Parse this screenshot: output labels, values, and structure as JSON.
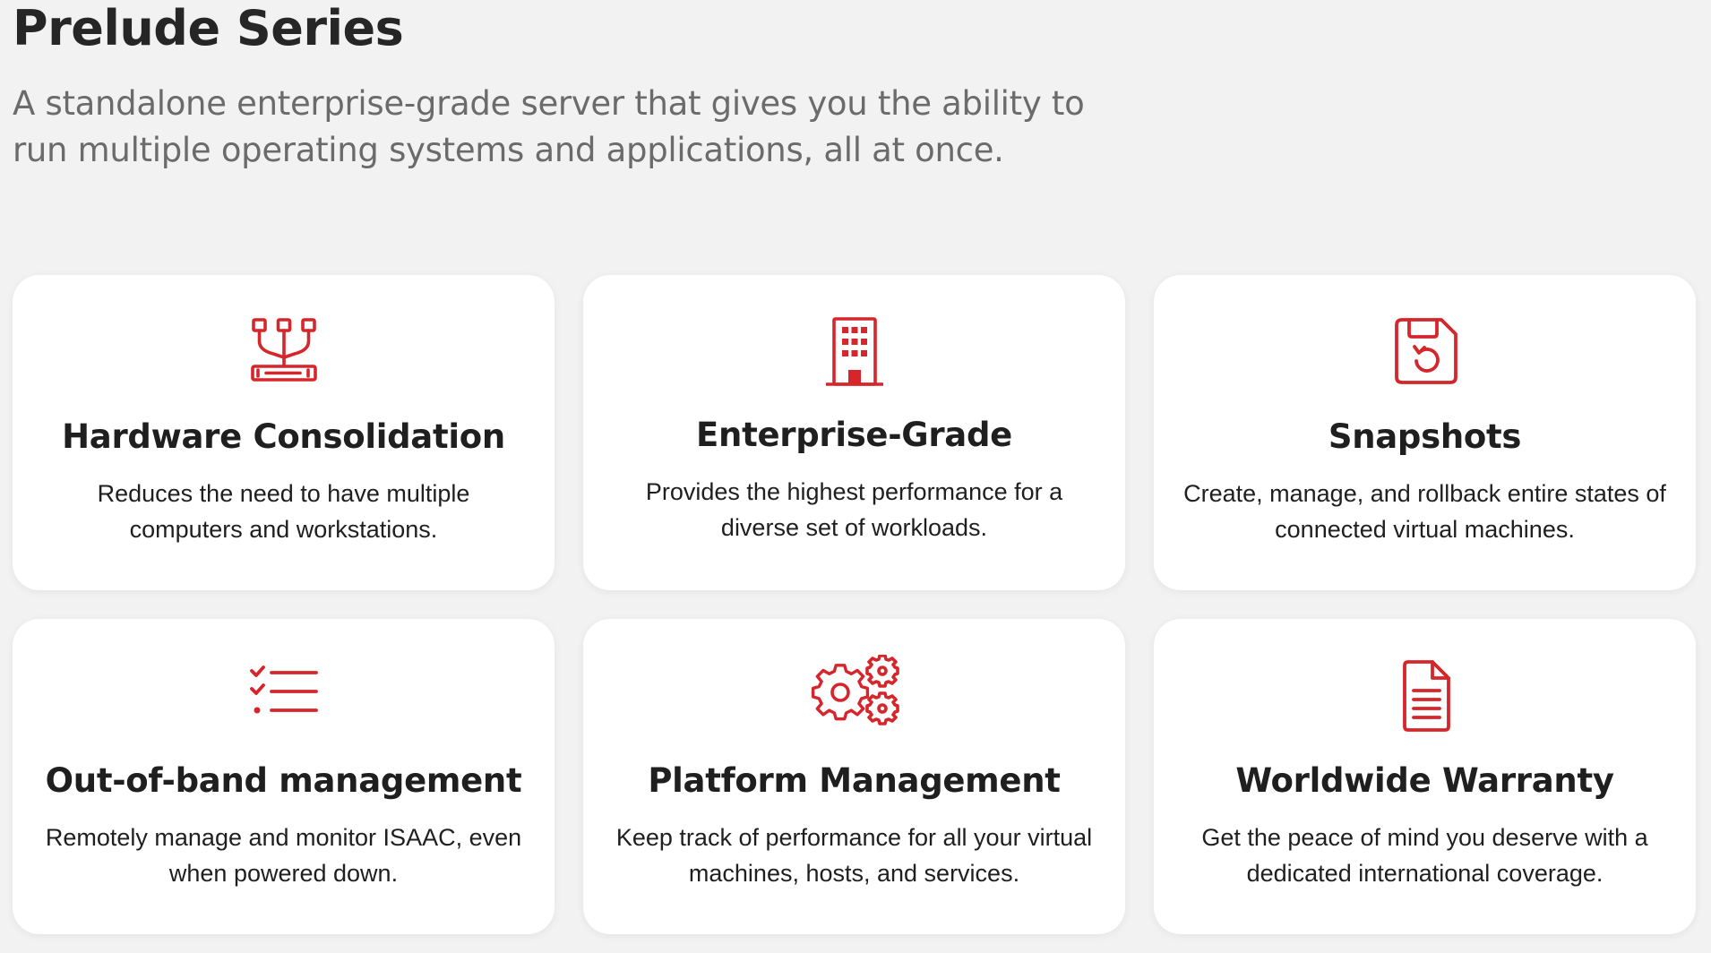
{
  "header": {
    "title": "Prelude Series",
    "subtitle": "A standalone enterprise-grade server that gives you the ability to run multiple operating systems and applications, all at once."
  },
  "theme": {
    "accent": "#d7262b",
    "background": "#f2f2f2",
    "card": "#ffffff"
  },
  "features": [
    {
      "icon": "hardware-consolidation-icon",
      "title": "Hardware Consolidation",
      "description": "Reduces the need to have multiple computers and workstations."
    },
    {
      "icon": "building-icon",
      "title": "Enterprise-Grade",
      "description": "Provides the highest performance for a diverse set of workloads."
    },
    {
      "icon": "save-restore-icon",
      "title": "Snapshots",
      "description": "Create, manage, and rollback entire states of connected virtual machines."
    },
    {
      "icon": "checklist-icon",
      "title": "Out-of-band management",
      "description": "Remotely manage and monitor ISAAC, even when powered down."
    },
    {
      "icon": "gears-icon",
      "title": "Platform Management",
      "description": "Keep track of performance for all your virtual machines, hosts, and services."
    },
    {
      "icon": "document-icon",
      "title": "Worldwide Warranty",
      "description": "Get the peace of mind you deserve with a dedicated international coverage."
    }
  ]
}
